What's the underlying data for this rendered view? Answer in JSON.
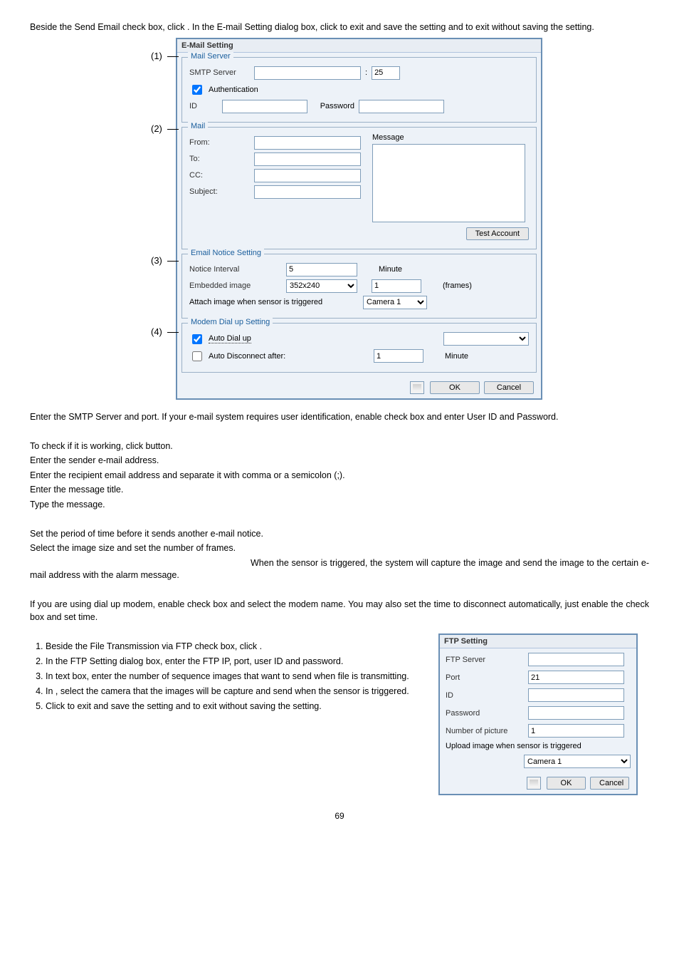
{
  "intro": {
    "p1a": "Beside the Send Email check box, click ",
    "p1b": ". In the E-mail Setting dialog box, click ",
    "p1c": " to exit and save the setting and ",
    "p1d": " to exit without saving the setting."
  },
  "callouts": {
    "c1": "(1)",
    "c2": "(2)",
    "c3": "(3)",
    "c4": "(4)"
  },
  "emailDialog": {
    "title": "E-Mail Setting",
    "grp1": "Mail Server",
    "smtp": "SMTP Server",
    "port": "25",
    "auth": "Authentication",
    "idLabel": "ID",
    "passLabel": "Password",
    "grp2": "Mail",
    "msg": "Message",
    "from": "From:",
    "to": "To:",
    "cc": "CC:",
    "subj": "Subject:",
    "testBtn": "Test Account",
    "grp3": "Email Notice Setting",
    "notice": "Notice Interval",
    "noticeVal": "5",
    "minute": "Minute",
    "embed": "Embedded image",
    "embedSize": "352x240",
    "embedFrames": "1",
    "frames": "(frames)",
    "attach": "Attach image when sensor is triggered",
    "attachCam": "Camera 1",
    "grp4": "Modem Dial up Setting",
    "autoDial": "Auto Dial up",
    "autoDisc": "Auto Disconnect after:",
    "autoDiscVal": "1",
    "ok": "OK",
    "cancel": "Cancel"
  },
  "midText": {
    "l1": "Enter the SMTP Server and port. If your e-mail system requires user identification, enable check box and enter User ID and Password.",
    "l2a": "To check if it is working, click ",
    "l2b": " button.",
    "l3": "Enter the sender e-mail address.",
    "l4": "Enter the recipient email address and separate it with comma or a semicolon (;).",
    "l5": "Enter the message title.",
    "l6": "Type the message.",
    "l7": "Set the period of time before it sends another e-mail notice.",
    "l8": "Select the image size and set the number of frames.",
    "l9": "When the sensor is triggered, the system will capture the image and send the image to the certain e-mail address with the alarm message.",
    "l10a": "If you are using dial up modem, enable ",
    "l10b": " check box and select the modem name. You may also set the time to disconnect automatically, just enable the ",
    "l10c": " check box and set time."
  },
  "ftpList": {
    "i1": "Beside the File Transmission via FTP check box, click .",
    "i2": "In the FTP Setting dialog box, enter the FTP IP, port, user ID and password.",
    "i3": "In   text box, enter the number of sequence images that want to send when file is transmitting.",
    "i4": "In   , select the camera that the images will be capture and send when the sensor is triggered.",
    "i5a": "Click ",
    "i5b": " to exit and save the setting and ",
    "i5c": " to exit without saving the setting."
  },
  "ftpDialog": {
    "title": "FTP Setting",
    "server": "FTP Server",
    "port": "Port",
    "portVal": "21",
    "id": "ID",
    "pass": "Password",
    "num": "Number of picture",
    "numVal": "1",
    "upload": "Upload image when sensor is triggered",
    "cam": "Camera 1",
    "ok": "OK",
    "cancel": "Cancel"
  },
  "pageNum": "69"
}
